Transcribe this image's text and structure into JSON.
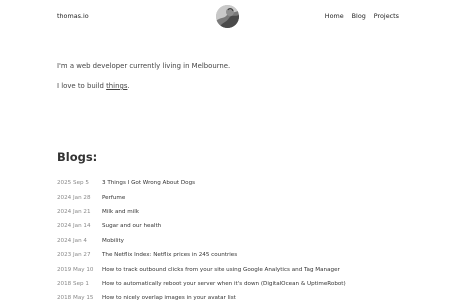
{
  "header": {
    "site_name": "thomas.io",
    "nav": [
      {
        "label": "Home"
      },
      {
        "label": "Blog"
      },
      {
        "label": "Projects"
      }
    ]
  },
  "intro": {
    "line1": "I'm a web developer currently living in Melbourne.",
    "line2_prefix": "I love to build ",
    "line2_link": "things",
    "line2_suffix": "."
  },
  "blogs": {
    "heading": "Blogs:",
    "posts": [
      {
        "date": "2025 Sep 5",
        "title": "3 Things I Got Wrong About Dogs"
      },
      {
        "date": "2024 Jan 28",
        "title": "Perfume"
      },
      {
        "date": "2024 Jan 21",
        "title": "Milk and milk"
      },
      {
        "date": "2024 Jan 14",
        "title": "Sugar and our health"
      },
      {
        "date": "2024 Jan 4",
        "title": "Mobility"
      },
      {
        "date": "2023 Jan 27",
        "title": "The Netflix Index: Netflix prices in 245 countries"
      },
      {
        "date": "2019 May 10",
        "title": "How to track outbound clicks from your site using Google Analytics and Tag Manager"
      },
      {
        "date": "2018 Sep 1",
        "title": "How to automatically reboot your server when it's down (DigitalOcean & UptimeRobot)"
      },
      {
        "date": "2018 May 15",
        "title": "How to nicely overlap images in your avatar list"
      }
    ]
  }
}
